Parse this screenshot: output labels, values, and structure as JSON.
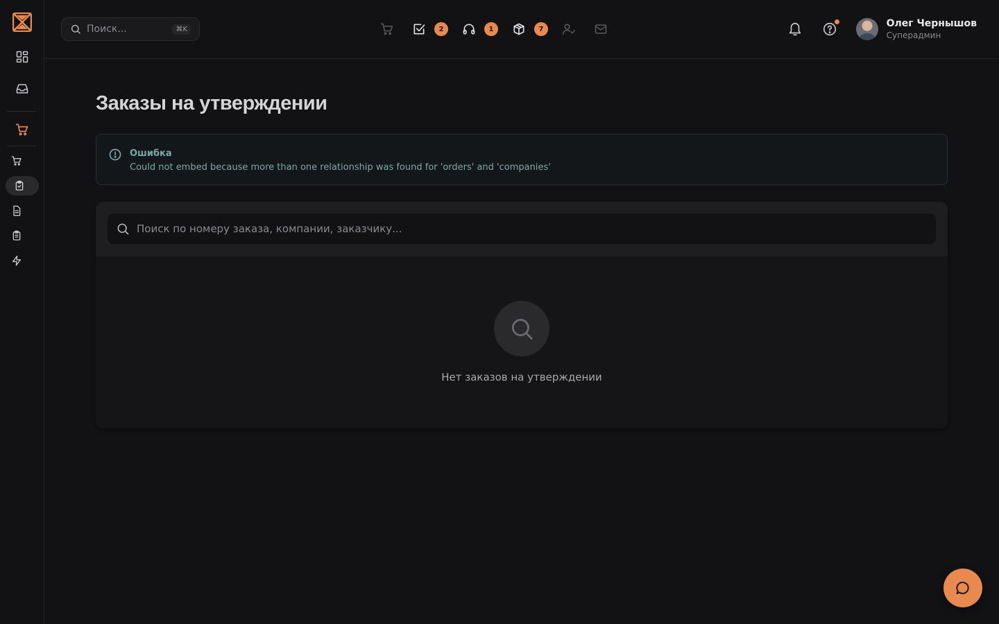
{
  "header": {
    "search_placeholder": "Поиск...",
    "search_shortcut": "⌘K",
    "badges": {
      "tasks": "2",
      "support": "1",
      "packages": "7"
    },
    "user": {
      "name": "Олег Чернышов",
      "role": "Суперадмин"
    }
  },
  "page": {
    "title": "Заказы на утверждении",
    "error": {
      "title": "Ошибка",
      "message": "Could not embed because more than one relationship was found for 'orders' and 'companies'"
    },
    "search_placeholder": "Поиск по номеру заказа, компании, заказчику...",
    "empty_text": "Нет заказов на утверждении"
  },
  "colors": {
    "accent": "#e8894f",
    "background": "#121214",
    "error_text": "#7aa9a6"
  },
  "icons": {
    "sidebar": [
      "logo-icon",
      "dashboard-icon",
      "inbox-icon",
      "cart-icon",
      "cart-small-icon",
      "clipboard-check-icon",
      "document-icon",
      "clipboard-list-icon",
      "lightning-icon"
    ],
    "header": [
      "search-icon",
      "cart-icon",
      "checkbox-icon",
      "headphones-icon",
      "package-icon",
      "user-check-icon",
      "mail-icon",
      "bell-icon",
      "help-icon"
    ],
    "fab": "chat-icon"
  }
}
